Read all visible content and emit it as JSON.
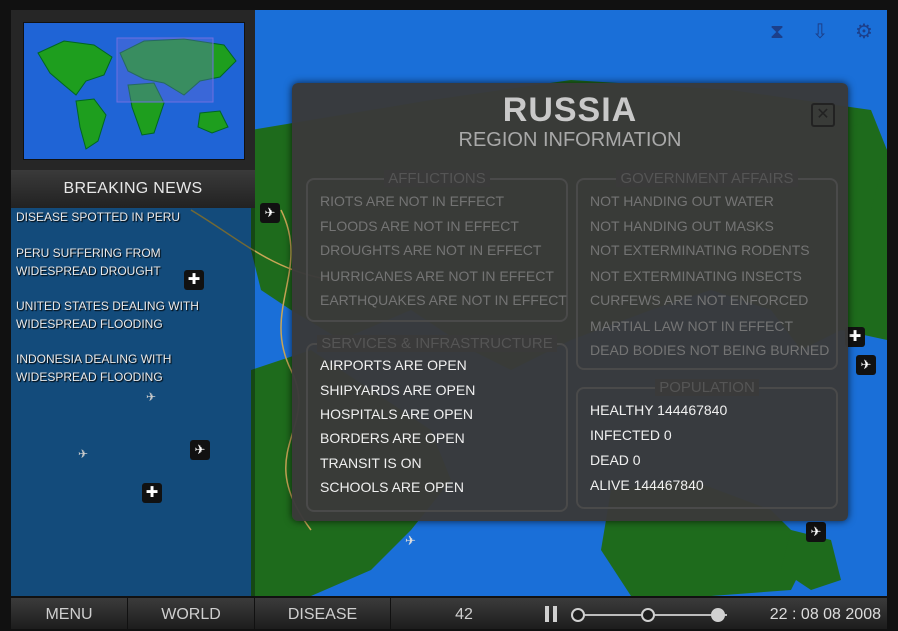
{
  "news": {
    "header": "BREAKING NEWS",
    "items": [
      "DISEASE SPOTTED IN PERU",
      "PERU SUFFERING FROM WIDESPREAD DROUGHT",
      "UNITED STATES DEALING WITH WIDESPREAD FLOODING",
      "INDONESIA DEALING WITH WIDESPREAD FLOODING"
    ]
  },
  "top_icons": [
    "hourglass-icon",
    "download-arrow-icon",
    "gear-icon"
  ],
  "dialog": {
    "title": "RUSSIA",
    "subtitle": "REGION INFORMATION",
    "close_icon": "close-icon",
    "afflictions": {
      "title": "AFFLICTIONS",
      "items": [
        "RIOTS ARE NOT IN EFFECT",
        "FLOODS ARE NOT IN EFFECT",
        "DROUGHTS ARE NOT IN EFFECT",
        "HURRICANES ARE NOT IN EFFECT",
        "EARTHQUAKES ARE NOT IN EFFECT"
      ]
    },
    "government": {
      "title": "GOVERNMENT AFFAIRS",
      "items": [
        "NOT HANDING OUT WATER",
        "NOT HANDING OUT MASKS",
        "NOT EXTERMINATING RODENTS",
        "NOT EXTERMINATING INSECTS",
        "CURFEWS ARE NOT ENFORCED",
        "MARTIAL LAW NOT IN EFFECT",
        "DEAD BODIES NOT BEING BURNED"
      ]
    },
    "services": {
      "title": "SERVICES & INFRASTRUCTURE",
      "items": [
        "AIRPORTS ARE OPEN",
        "SHIPYARDS ARE OPEN",
        "HOSPITALS ARE OPEN",
        "BORDERS ARE OPEN",
        "TRANSIT IS ON",
        "SCHOOLS ARE OPEN"
      ]
    },
    "population": {
      "title": "POPULATION",
      "items": [
        "HEALTHY 144467840",
        "INFECTED 0",
        "DEAD 0",
        "ALIVE 144467840"
      ]
    }
  },
  "bottom": {
    "menu": "MENU",
    "world": "WORLD",
    "disease": "DISEASE",
    "day_count": "42",
    "speed_levels": 3,
    "speed_selected": 3,
    "clock": "22 : 08 08 2008"
  },
  "colors": {
    "ocean": "#1a6fd8",
    "land": "#1e6b1c",
    "panel": "#3a3a3a"
  }
}
